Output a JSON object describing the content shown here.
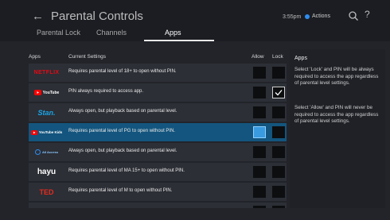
{
  "header": {
    "title": "Parental Controls",
    "clock": "3:55pm",
    "actions_label": "Actions"
  },
  "tabs": [
    {
      "label": "Parental Lock",
      "active": false
    },
    {
      "label": "Channels",
      "active": false
    },
    {
      "label": "Apps",
      "active": true
    }
  ],
  "columns": {
    "apps": "Apps",
    "current_settings": "Current Settings",
    "allow": "Allow",
    "lock": "Lock"
  },
  "rows": [
    {
      "app": "NETFLIX",
      "setting": "Requires parental level of 18+ to open without PIN.",
      "allow": false,
      "lock": false,
      "selected": false
    },
    {
      "app": "YouTube",
      "setting": "PIN always required to access app.",
      "allow": false,
      "lock": true,
      "selected": false
    },
    {
      "app": "Stan.",
      "setting": "Always open, but playback based on parental level.",
      "allow": false,
      "lock": false,
      "selected": false
    },
    {
      "app": "YouTube Kids",
      "setting": "Requires parental level of PG to open without PIN.",
      "allow": false,
      "lock": false,
      "selected": true
    },
    {
      "app": "All Access",
      "setting": "Always open, but playback based on parental level.",
      "allow": false,
      "lock": false,
      "selected": false
    },
    {
      "app": "hayu",
      "setting": "Requires parental level of MA 15+ to open without PIN.",
      "allow": false,
      "lock": false,
      "selected": false
    },
    {
      "app": "TED",
      "setting": "Requires parental level of M to open without PIN.",
      "allow": false,
      "lock": false,
      "selected": false
    }
  ],
  "info_panel": {
    "title": "Apps",
    "paragraph1": "Select 'Lock' and PIN will be always required to access the app regardless of parental level settings.",
    "paragraph2": "Select 'Allow' and PIN will never be required to access the app regardless of parental level settings."
  },
  "colors": {
    "selected_row": "#13557e",
    "accent": "#2e8df0",
    "netflix": "#e50914",
    "ted": "#e62b1e",
    "stan": "#1aa5e6"
  }
}
